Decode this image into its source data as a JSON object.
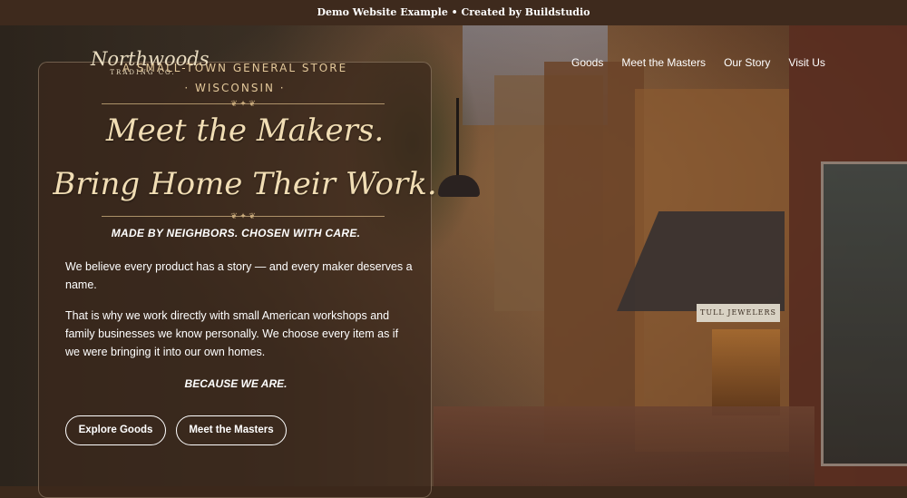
{
  "top_banner": {
    "text": "Demo Website Example • Created by Buildstudio"
  },
  "logo": {
    "name": "Northwoods",
    "sub": "TRADING CO."
  },
  "nav": {
    "items": [
      {
        "label": "Goods"
      },
      {
        "label": "Meet the Masters"
      },
      {
        "label": "Our Story"
      },
      {
        "label": "Visit Us"
      }
    ]
  },
  "hero": {
    "store_line": "A SMALL-TOWN GENERAL STORE",
    "state_line": "· WISCONSIN ·",
    "headline_1": "Meet the Makers.",
    "headline_2": "Bring Home Their Work.",
    "tagline": "MADE BY NEIGHBORS. CHOSEN WITH CARE.",
    "paragraph_1": "We believe every product has a story — and every maker deserves a name.",
    "paragraph_2": "That is why we work directly with small American workshops and family businesses we know personally. We choose every item as if we were bringing it into our own homes.",
    "closing": "BECAUSE WE ARE.",
    "buttons": {
      "explore": "Explore Goods",
      "masters": "Meet the Masters"
    }
  },
  "scene": {
    "shop_sign": "TULL JEWELERS"
  },
  "colors": {
    "top_bar": "#3e2a1d",
    "headline": "#f1ddb4",
    "accent_gold": "#e3c89a",
    "card_bg": "rgba(60,40,28,0.72)"
  }
}
